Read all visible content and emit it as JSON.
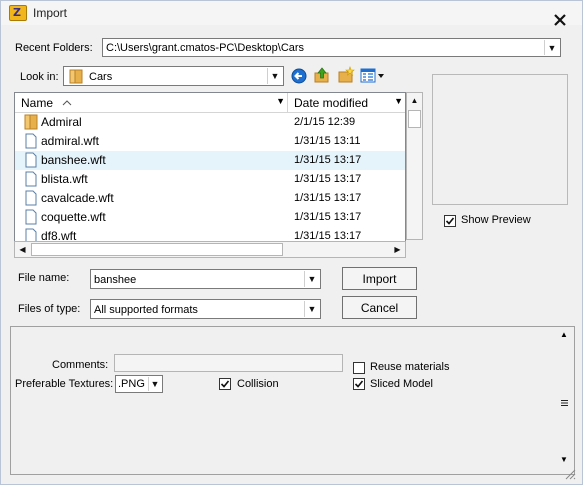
{
  "window": {
    "title": "Import",
    "close_label": "X"
  },
  "recent_folders": {
    "label": "Recent Folders:",
    "value": "C:\\Users\\grant.cmatos-PC\\Desktop\\Cars"
  },
  "look_in": {
    "label": "Look in:",
    "value": "Cars"
  },
  "file_list": {
    "headers": {
      "name": "Name",
      "date": "Date modified"
    },
    "rows": [
      {
        "name": "Admiral",
        "date": "2/1/15 12:39",
        "type": "folder"
      },
      {
        "name": "admiral.wft",
        "date": "1/31/15 13:11",
        "type": "file"
      },
      {
        "name": "banshee.wft",
        "date": "1/31/15 13:17",
        "type": "file",
        "selected": true
      },
      {
        "name": "blista.wft",
        "date": "1/31/15 13:17",
        "type": "file"
      },
      {
        "name": "cavalcade.wft",
        "date": "1/31/15 13:17",
        "type": "file"
      },
      {
        "name": "coquette.wft",
        "date": "1/31/15 13:17",
        "type": "file"
      },
      {
        "name": "df8.wft",
        "date": "1/31/15 13:17",
        "type": "file"
      }
    ]
  },
  "preview": {
    "show_preview_label": "Show Preview",
    "show_preview_checked": true
  },
  "file_name": {
    "label": "File name:",
    "value": "banshee"
  },
  "files_of_type": {
    "label": "Files of type:",
    "value": "All supported formats"
  },
  "buttons": {
    "import": "Import",
    "cancel": "Cancel"
  },
  "options": {
    "comments_label": "Comments:",
    "comments_value": "",
    "preferable_textures_label": "Preferable Textures:",
    "preferable_textures_value": ".PNG",
    "collision_label": "Collision",
    "collision_checked": true,
    "reuse_materials_label": "Reuse materials",
    "reuse_materials_checked": false,
    "sliced_model_label": "Sliced Model",
    "sliced_model_checked": true
  },
  "colors": {
    "selection": "#e5f3fb",
    "folder": "#e8b04a",
    "nav_blue": "#1e6fd0",
    "up_green": "#3fa21f"
  }
}
